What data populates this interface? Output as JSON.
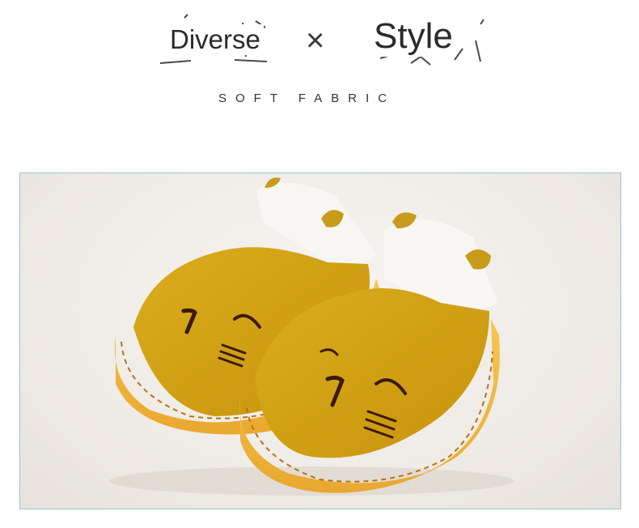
{
  "header": {
    "word_left": "Diverse",
    "separator": "×",
    "word_right": "Style",
    "subtitle": "SOFT FABRIC"
  },
  "colors": {
    "mustard": "#d4a514",
    "leather": "#f0b840",
    "stitch": "#b8720f",
    "frame_border": "#9fc4c8"
  }
}
